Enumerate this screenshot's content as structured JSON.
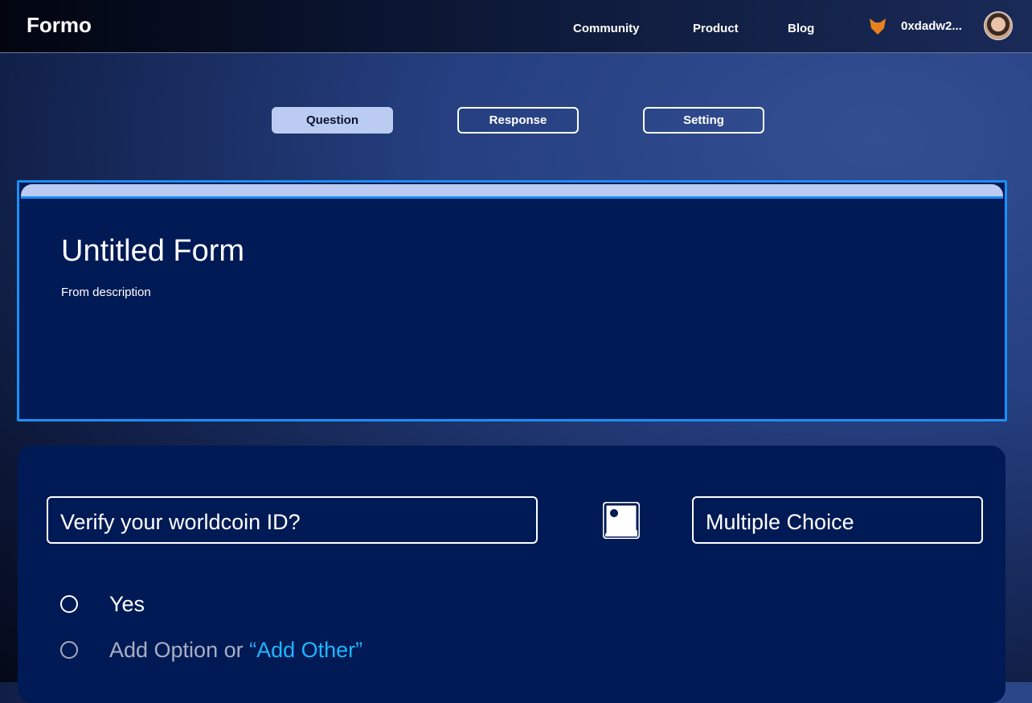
{
  "header": {
    "logo": "Formo",
    "nav": [
      "Community",
      "Product",
      "Blog"
    ],
    "wallet_address": "0xdadw2...",
    "wallet_icon": "metamask-fox-icon"
  },
  "tabs": [
    {
      "label": "Question",
      "active": true
    },
    {
      "label": "Response",
      "active": false
    },
    {
      "label": "Setting",
      "active": false
    }
  ],
  "form": {
    "title": "Untitled Form",
    "description": "From description"
  },
  "question": {
    "text": "Verify your worldcoin ID?",
    "type": "Multiple Choice",
    "options": [
      "Yes"
    ],
    "add_option": "Add Option or ",
    "add_other": "“Add Other”"
  },
  "colors": {
    "accent": "#1b8ff7",
    "card": "#001a55",
    "tab_active": "#bccbf2",
    "link": "#1fb6ff"
  }
}
